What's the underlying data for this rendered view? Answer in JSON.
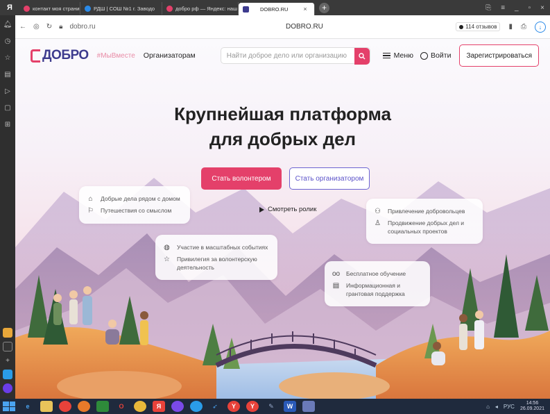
{
  "browser": {
    "tabs": [
      {
        "label": "контакт моя страница —",
        "color": "#e4406a"
      },
      {
        "label": "РДШ | СОШ №1 г. Заводо",
        "color": "#2a8ae8"
      },
      {
        "label": "добро рф — Яндекс: наш",
        "color": "#e4406a"
      },
      {
        "label": "DOBRO.RU",
        "color": "#3d3b8e",
        "active": true
      }
    ],
    "url": "dobro.ru",
    "page_title": "DOBRO.RU",
    "reviews": "114 отзывов"
  },
  "site": {
    "logo": "ДОБРО",
    "tagline": "#МыВместе",
    "organizers_link": "Организаторам",
    "search_placeholder": "Найти доброе дело или организацию",
    "menu": "Меню",
    "login": "Войти",
    "register": "Зарегистрироваться",
    "hero_line1": "Крупнейшая платформа",
    "hero_line2": "для добрых дел",
    "cta_volunteer": "Стать волонтером",
    "cta_organizer": "Стать организатором",
    "video": "Смотреть ролик",
    "features": {
      "left": [
        "Добрые дела рядом с домом",
        "Путешествия со смыслом"
      ],
      "middle": [
        "Участие в масштабных событиях",
        "Привилегия за волонтерскую деятельность"
      ],
      "right_top": [
        "Привлечение добровольцев",
        "Продвижение добрых дел и социальных проектов"
      ],
      "right_bottom": [
        "Бесплатное обучение",
        "Информационная и грантовая поддержка"
      ]
    }
  },
  "taskbar": {
    "lang": "РУС",
    "time": "14:56",
    "date": "26.09.2021"
  },
  "colors": {
    "brand_pink": "#e4406a",
    "brand_indigo": "#3d3b8e",
    "accent_violet": "#6b63d1"
  }
}
